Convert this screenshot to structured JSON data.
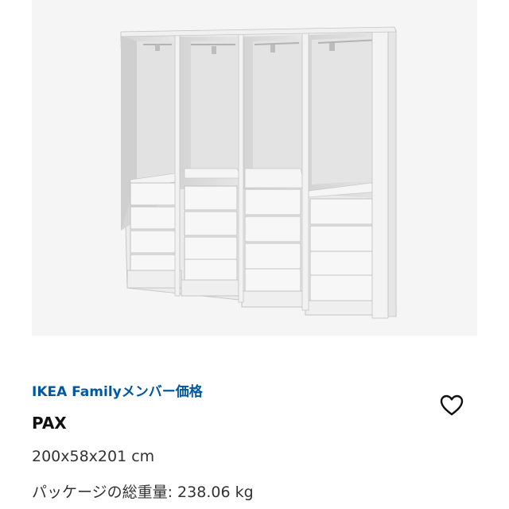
{
  "product": {
    "image_alt": "PAX",
    "family_price_label": "IKEA Familyメンバー価格",
    "name": "PAX",
    "dimensions": "200x58x201 cm",
    "weight": "パッケージの総重量: 238.06 kg"
  },
  "actions": {
    "favorite_icon": "heart-outline-icon"
  },
  "colors": {
    "brand_blue": "#0058a3",
    "image_background": "#f5f5f5"
  }
}
